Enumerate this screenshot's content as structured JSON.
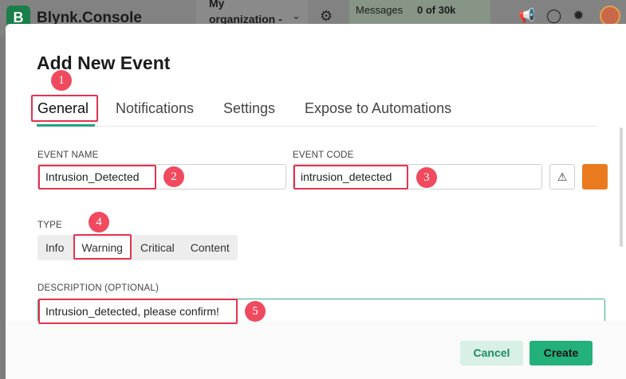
{
  "app": {
    "logo_letter": "B",
    "title": "Blynk.Console",
    "org_selector": "My organization - ...",
    "messages_label": "Messages",
    "messages_count": "0 of 30k"
  },
  "modal": {
    "title": "Add New Event",
    "tabs": [
      {
        "label": "General",
        "active": true
      },
      {
        "label": "Notifications"
      },
      {
        "label": "Settings"
      },
      {
        "label": "Expose to Automations"
      }
    ],
    "event_name": {
      "label": "EVENT NAME",
      "value": "Intrusion_Detected"
    },
    "event_code": {
      "label": "EVENT CODE",
      "value": "intrusion_detected"
    },
    "event_color": "#ea7a1e",
    "type": {
      "label": "TYPE",
      "options": [
        "Info",
        "Warning",
        "Critical",
        "Content"
      ],
      "selected": "Warning"
    },
    "description": {
      "label": "DESCRIPTION (OPTIONAL)",
      "value": "Intrusion_detected, please confirm!"
    },
    "buttons": {
      "cancel": "Cancel",
      "create": "Create"
    }
  },
  "annotations": [
    "1",
    "2",
    "3",
    "4",
    "5"
  ],
  "colors": {
    "accent": "#23b07a",
    "highlight": "#e5334f",
    "marker": "#f04a5e"
  }
}
